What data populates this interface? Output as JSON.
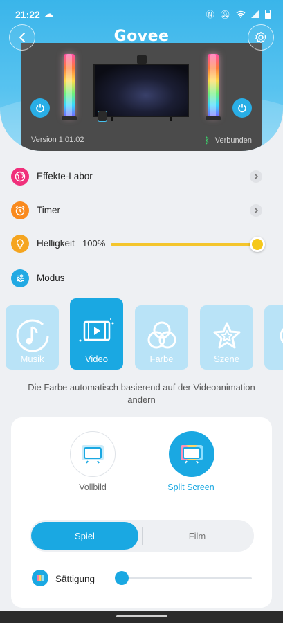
{
  "status_bar": {
    "time": "21:22"
  },
  "header": {
    "logo": "Govee"
  },
  "device": {
    "version": "Version 1.01.02",
    "connection": "Verbunden"
  },
  "rows": {
    "effects_lab": "Effekte-Labor",
    "timer": "Timer",
    "brightness": {
      "label": "Helligkeit",
      "value": "100%",
      "level": 1.0
    },
    "mode": "Modus"
  },
  "modes": [
    {
      "label": "Musik",
      "icon": "music-note-icon"
    },
    {
      "label": "Video",
      "icon": "video-icon",
      "active": true
    },
    {
      "label": "Farbe",
      "icon": "color-circles-icon"
    },
    {
      "label": "Szene",
      "icon": "star-icon"
    }
  ],
  "description": "Die Farbe automatisch basierend auf der Videoanimation ändern",
  "video_panel": {
    "options": [
      {
        "label": "Vollbild",
        "icon": "tv-icon"
      },
      {
        "label": "Split Screen",
        "icon": "split-tv-icon",
        "selected": true
      }
    ],
    "segments": {
      "active": "Spiel",
      "other": "Film"
    },
    "saturation": {
      "label": "Sättigung",
      "level": 0.0
    }
  },
  "colors": {
    "accent": "#1aa8e2",
    "brightness": "#f5c81b",
    "header": "#3ab5ea"
  }
}
